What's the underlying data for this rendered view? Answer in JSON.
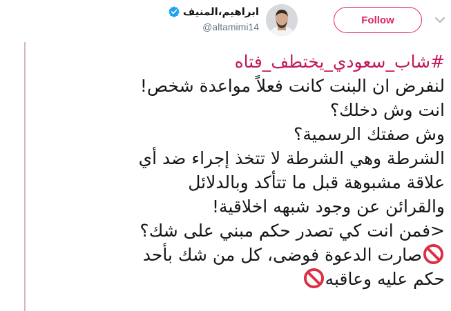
{
  "user": {
    "display_name": "ابراهيم،المنيف",
    "handle": "@altamimi14",
    "verified": true
  },
  "actions": {
    "follow_label": "Follow"
  },
  "tweet": {
    "hashtag": "#شاب_سعودي_يختطف_فتاه",
    "lines": [
      "لنفرض ان البنت كانت فعلاً مواعدة شخص!",
      "انت وش دخلك؟",
      "وش صفتك الرسمية؟",
      "الشرطة وهي الشرطة لا تتخذ إجراء ضد أي",
      "علاقة مشبوهة قبل ما تتأكد وبالدلائل",
      "والقرائن عن وجود شبهه اخلاقية!",
      "<فمن انت كي تصدر حكم مبني على شك؟",
      "صارت الدعوة فوضى، كل من شك بأحد",
      "حكم عليه وعاقبه"
    ]
  },
  "colors": {
    "accent": "#e0245e",
    "hashtag": "#c2185b",
    "thread_line": "#d9b3c9",
    "verified": "#1da1f2",
    "no_entry": "#dd2e44"
  },
  "icons": {
    "verified": "verified-badge-icon",
    "chevron": "chevron-down-icon",
    "no_entry": "no-entry-emoji-icon"
  }
}
